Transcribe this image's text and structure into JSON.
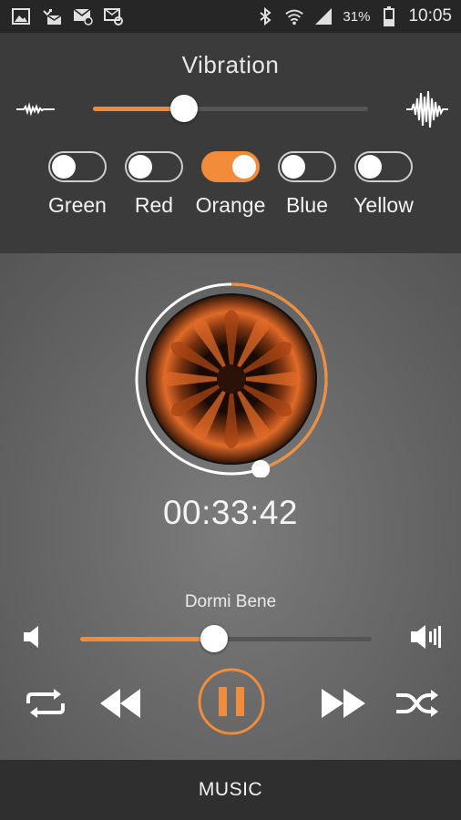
{
  "status_bar": {
    "left_icons": [
      "gallery-icon",
      "missed-call-icon",
      "message-icon",
      "settings-mail-icon"
    ],
    "right_icons": [
      "bluetooth-icon",
      "wifi-icon",
      "signal-icon",
      "battery-icon"
    ],
    "battery_percent": "31%",
    "time": "10:05"
  },
  "vibration": {
    "title": "Vibration",
    "intensity": 0.33,
    "low_icon": "weak-wave-icon",
    "high_icon": "strong-wave-icon",
    "colors": [
      {
        "label": "Green",
        "on": false
      },
      {
        "label": "Red",
        "on": false
      },
      {
        "label": "Orange",
        "on": true
      },
      {
        "label": "Blue",
        "on": false
      },
      {
        "label": "Yellow",
        "on": false
      }
    ]
  },
  "player": {
    "progress": 0.45,
    "elapsed": "00:33:42",
    "track_title": "Dormi Bene",
    "volume": 0.46,
    "is_playing": true,
    "controls": [
      "repeat-icon",
      "rewind-icon",
      "pause-icon",
      "fast-forward-icon",
      "shuffle-icon"
    ]
  },
  "bottom_bar": {
    "label": "MUSIC"
  },
  "colors": {
    "accent": "#f28c3a",
    "track": "#555555",
    "header_bg": "#3b3b3b",
    "bottom_bg": "#2f2f2f"
  }
}
